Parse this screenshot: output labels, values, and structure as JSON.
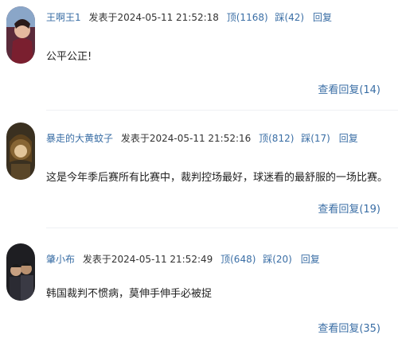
{
  "comments": [
    {
      "username": "王啊王1",
      "posted": "发表于2024-05-11 21:52:18",
      "up": "顶(1168)",
      "down": "踩(42)",
      "reply": "回复",
      "text": "公平公正!",
      "view_replies": "查看回复(14)"
    },
    {
      "username": "暴走的大黄蚊子",
      "posted": "发表于2024-05-11 21:52:16",
      "up": "顶(812)",
      "down": "踩(17)",
      "reply": "回复",
      "text": "这是今年季后赛所有比赛中，裁判控场最好，球迷看的最舒服的一场比赛。",
      "view_replies": "查看回复(19)"
    },
    {
      "username": "肇小布",
      "posted": "发表于2024-05-11 21:52:49",
      "up": "顶(648)",
      "down": "踩(20)",
      "reply": "回复",
      "text": "韩国裁判不惯病，莫伸手伸手必被捉",
      "view_replies": "查看回复(35)"
    }
  ]
}
